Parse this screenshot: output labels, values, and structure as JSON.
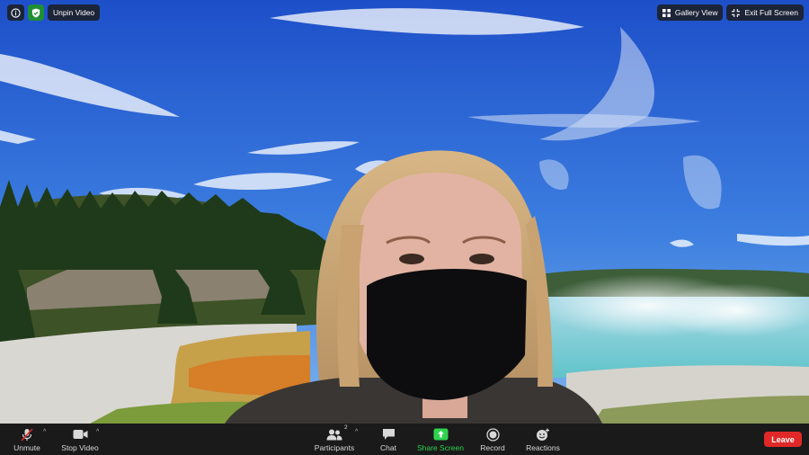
{
  "top_left": {
    "info_icon": "info-icon",
    "security_icon": "shield-check-icon",
    "unpin_label": "Unpin Video"
  },
  "top_right": {
    "gallery_label": "Gallery View",
    "fullscreen_label": "Exit Full Screen"
  },
  "toolbar": {
    "unmute_label": "Unmute",
    "stop_video_label": "Stop Video",
    "participants_label": "Participants",
    "participants_count": "2",
    "chat_label": "Chat",
    "share_label": "Share Screen",
    "record_label": "Record",
    "reactions_label": "Reactions",
    "leave_label": "Leave"
  },
  "colors": {
    "toolbar_bg": "#1a1a1a",
    "share_green": "#2ed34e",
    "leave_red": "#e02828",
    "security_green": "#1f8f35"
  }
}
